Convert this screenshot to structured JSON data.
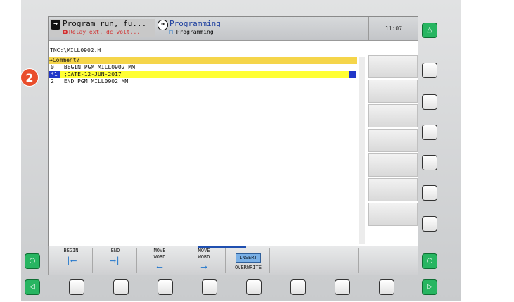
{
  "mode_bar": {
    "mode1_icon": "arrow-right-icon",
    "mode1_title": "Program run, fu...",
    "mode1_status": "Relay ext. dc volt...",
    "mode2_icon": "arrow-right-circle-icon",
    "mode2_title": "Programming",
    "mode2_subtitle": "Programming"
  },
  "clock": "11:07",
  "file_path": "TNC:\\MILL0902.H",
  "prompt": "→Comment?",
  "program_lines": [
    {
      "num": "0",
      "text": "BEGIN PGM MILL0902 MM"
    },
    {
      "num": "*1",
      "text": ";DATE-12-JUN-2017"
    },
    {
      "num": "2",
      "text": "END PGM MILL0902 MM"
    }
  ],
  "callout_number": "2",
  "softkeys": {
    "begin": "BEGIN",
    "end": "END",
    "move_word_left_1": "MOVE",
    "move_word_left_2": "WORD",
    "move_word_right_1": "MOVE",
    "move_word_right_2": "WORD",
    "insert": "INSERT",
    "overwrite": "OVERWRITE"
  },
  "colors": {
    "highlight": "#ffff33",
    "prompt": "#f5d54a",
    "selection": "#2036c8",
    "hw_green": "#27b561",
    "callout": "#e94e2c"
  }
}
